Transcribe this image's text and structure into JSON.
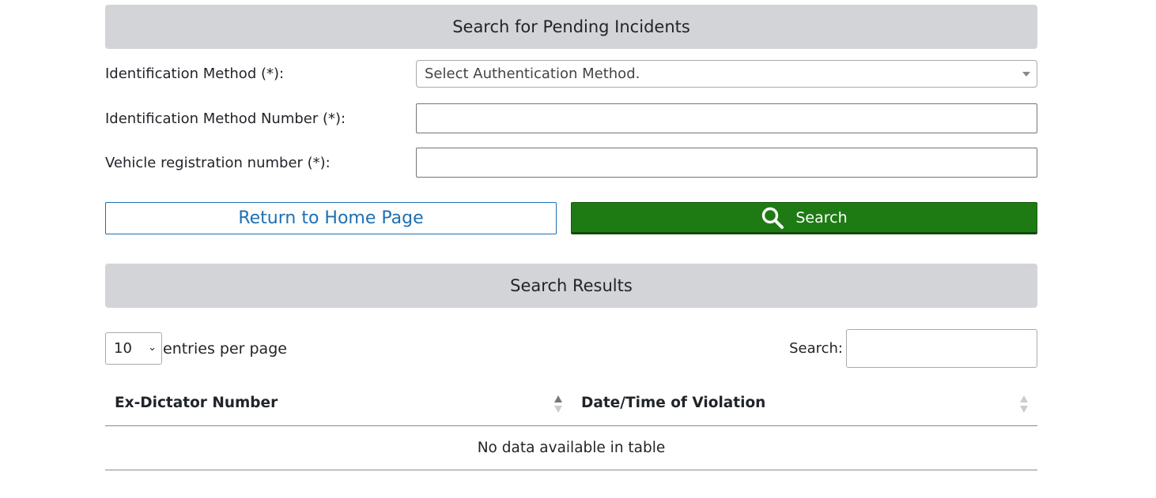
{
  "search_panel": {
    "title": "Search for Pending Incidents",
    "fields": {
      "identification_method_label": "Identification Method (*):",
      "identification_method_placeholder": "Select Authentication Method.",
      "identification_number_label": "Identification Method Number (*):",
      "identification_number_value": "",
      "vehicle_registration_label": "Vehicle registration number (*):",
      "vehicle_registration_value": ""
    },
    "buttons": {
      "return_home": "Return to Home Page",
      "search": "Search"
    },
    "colors": {
      "header_bg": "#d3d4d8",
      "search_button_bg": "#1e7b14",
      "link_blue": "#1f6fb2"
    }
  },
  "results_panel": {
    "title": "Search Results",
    "page_length": {
      "selected": "10",
      "label": "entries per page"
    },
    "table_search_label": "Search:",
    "columns": [
      {
        "label": "Ex-Dictator Number",
        "sort": "ascending"
      },
      {
        "label": "Date/Time of Violation",
        "sort": "none"
      }
    ],
    "empty_message": "No data available in table"
  },
  "icons": {
    "search_button_icon": "search-icon",
    "select_arrow": "caret-down-icon",
    "sort_column_1": "sort-asc-icon",
    "sort_column_2": "sort-both-icon"
  }
}
